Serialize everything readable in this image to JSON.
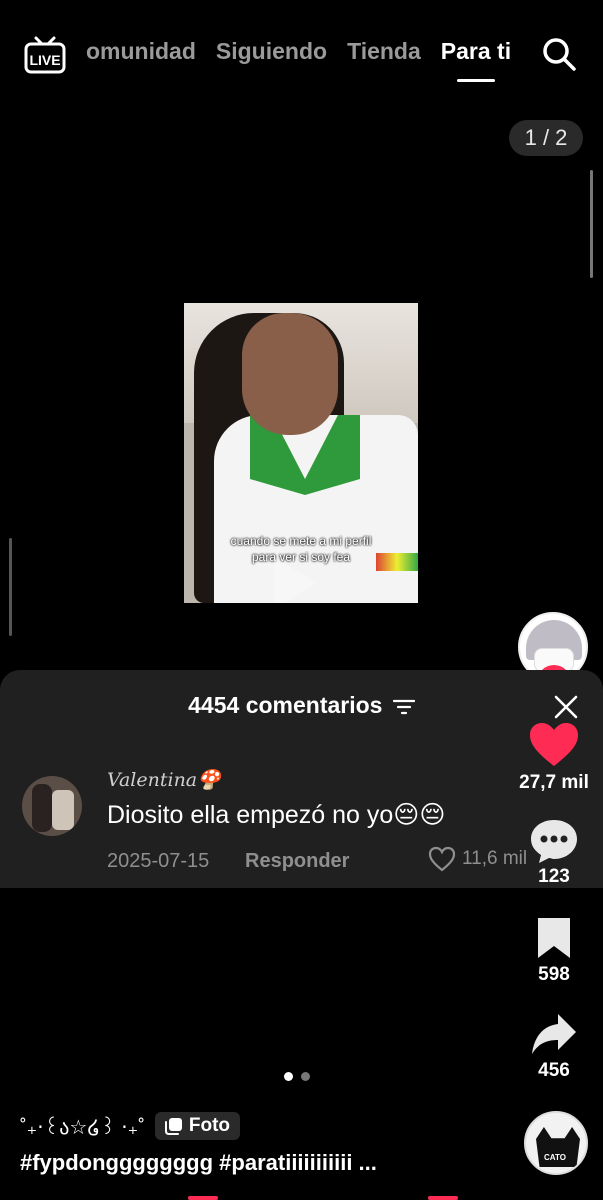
{
  "top_nav": {
    "live_label": "LIVE",
    "tabs": [
      {
        "label": "omunidad",
        "active": false
      },
      {
        "label": "Siguiendo",
        "active": false
      },
      {
        "label": "Tienda",
        "active": false
      },
      {
        "label": "Para ti",
        "active": true
      }
    ],
    "icons": {
      "live": "live-tv-icon",
      "search": "search-icon"
    }
  },
  "page_counter": "1 / 2",
  "video": {
    "caption_line1": "cuando se mete a mi perfil",
    "caption_line2": "para ver si soy fea"
  },
  "actions": {
    "likes": "27,7 mil",
    "comments": "123",
    "saves": "598",
    "shares": "456",
    "like_color": "#fe2c55"
  },
  "comments": {
    "header": "4454 comentarios",
    "items": [
      {
        "username": "Valentina🍄",
        "text": "Diosito ella empezó no yo😔😔",
        "date": "2025-07-15",
        "reply_label": "Responder",
        "likes": "11,6 mil"
      }
    ]
  },
  "carousel": {
    "total": 2,
    "active_index": 0
  },
  "description": {
    "prefix": "˚₊‧꒰ა☆໒꒱ ‧₊˚",
    "badge": "Foto",
    "hashtags": "#fypdongggggggg #paratiiiiiiiiiii ..."
  },
  "music_disc_label": "CATO"
}
